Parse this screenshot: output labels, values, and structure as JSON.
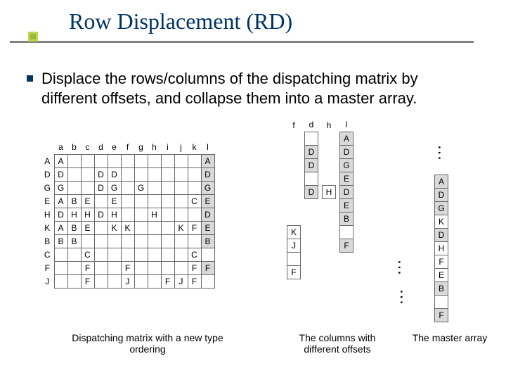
{
  "title": "Row Displacement (RD)",
  "bullet": "Displace the rows/columns of the dispatching matrix by different offsets, and collapse them into a master array.",
  "captions": {
    "c1": "Dispatching matrix with a new type ordering",
    "c2": "The columns with different offsets",
    "c3": "The master array"
  },
  "big_matrix": {
    "col_headers": [
      "a",
      "b",
      "c",
      "d",
      "e",
      "f",
      "g",
      "h",
      "i",
      "j",
      "k",
      "l"
    ],
    "row_headers": [
      "A",
      "D",
      "G",
      "E",
      "H",
      "K",
      "B",
      "C",
      "F",
      "J"
    ],
    "cells": {
      "A": {
        "a": "A",
        "l": "A"
      },
      "D": {
        "a": "D",
        "d": "D",
        "e": "D",
        "l": "D"
      },
      "G": {
        "a": "G",
        "d": "D",
        "e": "G",
        "g": "G",
        "l": "G"
      },
      "E": {
        "a": "A",
        "b": "B",
        "c": "E",
        "e": "E",
        "k": "C",
        "l": "E"
      },
      "H": {
        "a": "D",
        "b": "H",
        "c": "H",
        "d": "D",
        "e": "H",
        "h": "H",
        "l": "D"
      },
      "K": {
        "a": "A",
        "b": "B",
        "c": "E",
        "e": "K",
        "f": "K",
        "j": "K",
        "k": "F",
        "l": "E"
      },
      "B": {
        "a": "B",
        "b": "B",
        "l": "B"
      },
      "C": {
        "c": "C",
        "k": "C"
      },
      "F": {
        "c": "F",
        "f": "F",
        "k": "F",
        "l": "F"
      },
      "J": {
        "c": "F",
        "f": "J",
        "i": "F",
        "j": "J",
        "k": "F"
      }
    },
    "highlight_col": "l"
  },
  "columns_fig": {
    "strips": [
      {
        "header": "f",
        "start": 7,
        "values": [
          "K",
          "J",
          "",
          "F"
        ],
        "hl": []
      },
      {
        "header": "d",
        "start": 0,
        "values": [
          "",
          "D",
          "D",
          "",
          "D"
        ],
        "hl": [
          1,
          2,
          4
        ]
      },
      {
        "header": "h",
        "start": 4,
        "values": [
          "H"
        ],
        "hl": []
      },
      {
        "header": "l",
        "start": 0,
        "values": [
          "A",
          "D",
          "G",
          "E",
          "D",
          "E",
          "B",
          "",
          "F"
        ],
        "hl": [
          0,
          1,
          2,
          3,
          4,
          5,
          6,
          8
        ]
      }
    ]
  },
  "master": {
    "header": "",
    "values": [
      "A",
      "D",
      "G",
      "K",
      "D",
      "H",
      "F",
      "E",
      "B",
      "",
      "F"
    ],
    "hl": [
      0,
      1,
      2,
      4,
      8,
      10
    ]
  }
}
